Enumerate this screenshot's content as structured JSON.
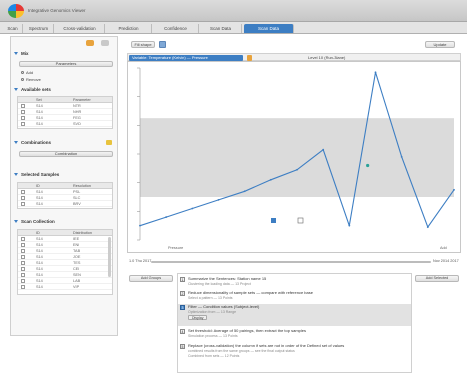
{
  "app": {
    "title": "Integrative Genomics Viewer"
  },
  "tabs": [
    {
      "label": "Scan"
    },
    {
      "label": "Spectrum"
    },
    {
      "label": "Cross-validation"
    },
    {
      "label": "Prediction"
    },
    {
      "label": "Confidence"
    },
    {
      "label": "Scan Data"
    },
    {
      "label": "Scan Data",
      "active": true
    }
  ],
  "left": {
    "section_1": "Mix",
    "parameters_button": "Parameters",
    "radio_1": "Add",
    "radio_2": "Remove",
    "section_2": "Available sets",
    "table_1": {
      "header": [
        "Set",
        "Parameter"
      ],
      "rows": [
        [
          "S14",
          "NTR"
        ],
        [
          "S14",
          "NHR"
        ],
        [
          "S14",
          "FEG"
        ],
        [
          "S14",
          "SVD"
        ]
      ]
    },
    "section_3": "Combinations",
    "combination_button": "Combination",
    "section_4": "Selected Samples",
    "table_2": {
      "header": [
        "ID",
        "Resolution"
      ],
      "rows": [
        [
          "S14",
          "PSL"
        ],
        [
          "S14",
          "SLC"
        ],
        [
          "S14",
          "BRV"
        ]
      ]
    },
    "section_5": "Scan Collection",
    "table_3": {
      "header": [
        "ID",
        "Distribution"
      ],
      "rows": [
        [
          "S14",
          "IEE"
        ],
        [
          "S14",
          "ENI"
        ],
        [
          "S14",
          "TAB"
        ],
        [
          "S14",
          "JOE"
        ],
        [
          "S14",
          "TES"
        ],
        [
          "S14",
          "CEI"
        ],
        [
          "S14",
          "SEN"
        ],
        [
          "S14",
          "LAB"
        ],
        [
          "S14",
          "VIP"
        ]
      ]
    }
  },
  "main": {
    "tool_label": "Fill shape",
    "top_right_button": "Update",
    "selected_label": "Variable: Temperature (Kelvin) — Pressure",
    "chart_header_right": "Level 10 (Run-3lane)",
    "slider_left": "1.0 Thu 2017",
    "slider_right": "Nov 2014 2017",
    "chart_bottom_left": "Pressure",
    "chart_bottom_right": "Add",
    "side_left_button": "Add Groups",
    "side_right_button": "Add Selected",
    "list": [
      {
        "n": "1",
        "title": "Summarize the Sentences: Station name 15",
        "sub": "Clustering the loading data — 13 Project",
        "blue": false
      },
      {
        "n": "2",
        "title": "Reduce dimensionality of sample sets — compare with reference base",
        "sub": "Select a pattern — 13 Points",
        "blue": false
      },
      {
        "n": "3",
        "title": "Filter — Condition values (Subject-level)",
        "sub": "Optimization from — 13 Range",
        "button": "Display",
        "blue": true
      },
      {
        "n": "4",
        "title": "Set threshold: Average of 50 pairings, then extract the top samples",
        "sub": "Simulation process — 13 Points",
        "blue": false
      },
      {
        "n": "5",
        "title": "Replace (cross-validation) the column if sets are not in order of the Defined set of values",
        "sub": "combined results from the same groups — see the final output status",
        "sub2": "Combined from sets — 12 Points",
        "blue": false
      }
    ]
  },
  "chart_data": {
    "type": "line",
    "title": "",
    "x": [
      0,
      1,
      2,
      3,
      4,
      5,
      6,
      7,
      8,
      9,
      10,
      11,
      12
    ],
    "y": [
      1.0,
      1.6,
      2.2,
      2.8,
      3.4,
      4.2,
      4.9,
      6.3,
      1.0,
      11.7,
      5.8,
      0.9,
      3.5
    ],
    "band": [
      3.0,
      8.5
    ],
    "ylim": [
      0,
      12
    ],
    "series_color": "#3d7ec3",
    "band_color": "#cfcfcf",
    "grid": false
  }
}
